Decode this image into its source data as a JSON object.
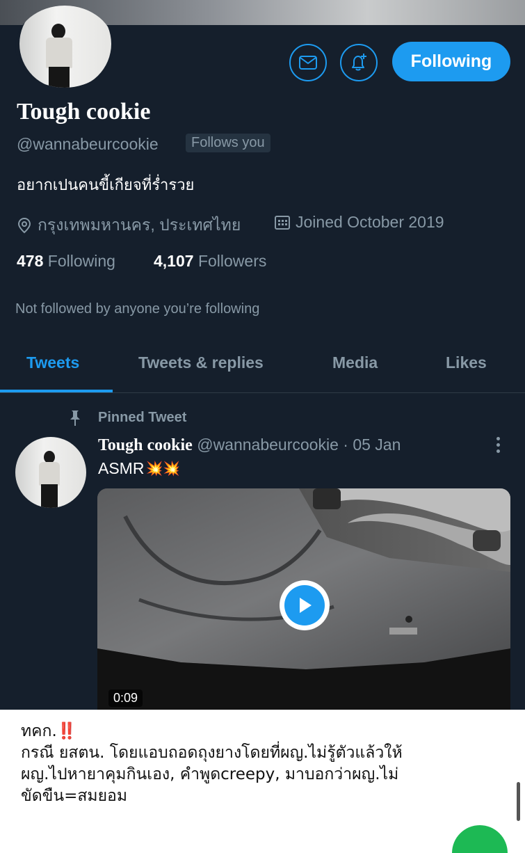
{
  "profile": {
    "name": "Tough cookie",
    "handle": "@wannabeurcookie",
    "follows_you": "Follows you",
    "bio": "อยากเปนคนขี้เกียจที่ร่ำรวย",
    "location": "กรุงเทพมหานคร, ประเทศไทย",
    "joined": "Joined October 2019",
    "following_count": "478",
    "following_label": "Following",
    "followers_count": "4,107",
    "followers_label": "Followers",
    "not_followed": "Not followed by anyone you’re following"
  },
  "actions": {
    "message_icon": "mail-icon",
    "notify_icon": "bell-plus-icon",
    "follow_button": "Following"
  },
  "tabs": [
    {
      "label": "Tweets",
      "active": true
    },
    {
      "label": "Tweets & replies",
      "active": false
    },
    {
      "label": "Media",
      "active": false
    },
    {
      "label": "Likes",
      "active": false
    }
  ],
  "tweet": {
    "pinned_label": "Pinned Tweet",
    "author": "Tough cookie",
    "handle": "@wannabeurcookie",
    "date": "· 05 Jan",
    "text": "ASMR",
    "emoji": "💥💥",
    "duration": "0:09"
  },
  "caption": {
    "line1": "ทคก.",
    "line1_mark": "‼️",
    "line2": "กรณี ยสตน. โดยแอบถอดถุงยางโดยที่ผญ.ไม่รู้ตัวแล้วให้",
    "line3": "ผญ.ไปหายาคุมกินเอง, คำพูดcreepy, มาบอกว่าผญ.ไม่",
    "line4": "ขัดขืน=สมยอม"
  },
  "colors": {
    "background": "#151f2c",
    "accent": "#1d9bf0",
    "muted": "#8899a6"
  }
}
